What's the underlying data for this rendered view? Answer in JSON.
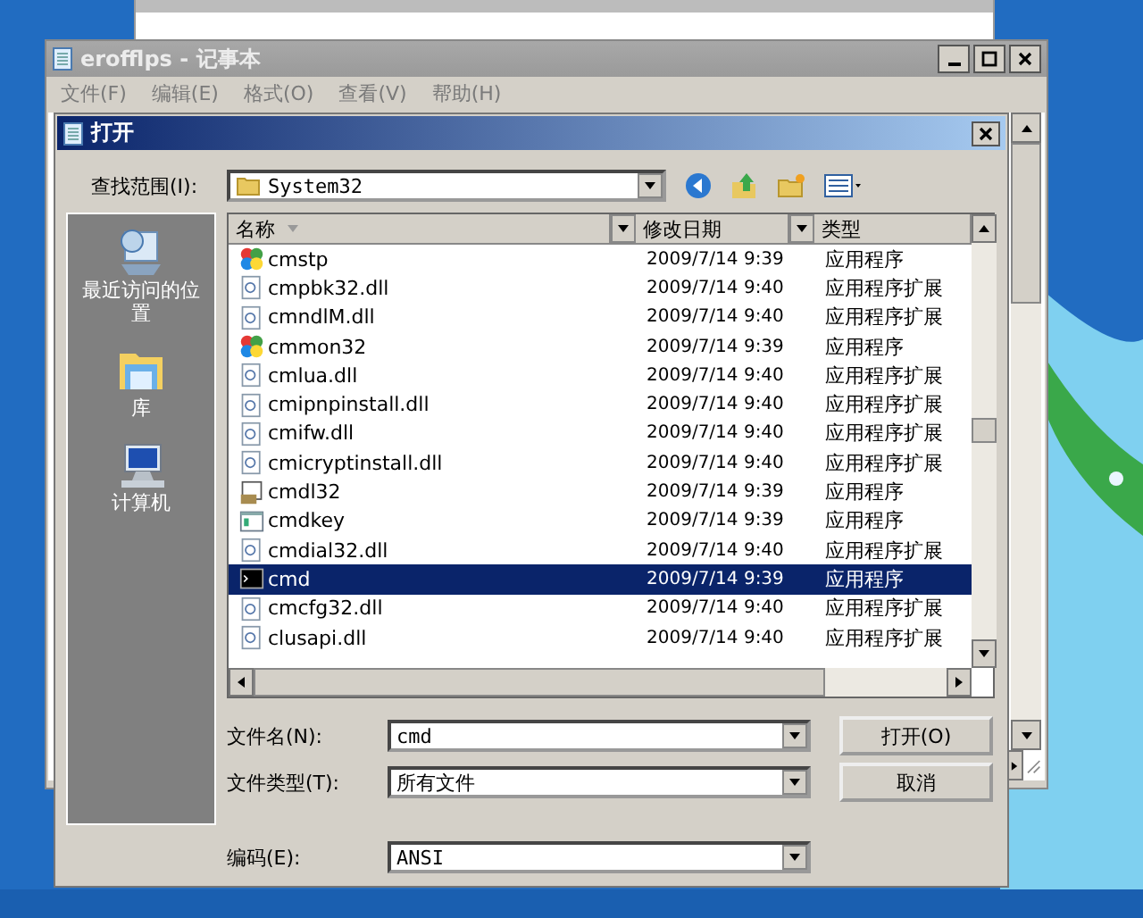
{
  "notepad": {
    "title": "erofflps - 记事本",
    "menu": [
      "文件(F)",
      "编辑(E)",
      "格式(O)",
      "查看(V)",
      "帮助(H)"
    ]
  },
  "dialog": {
    "title": "打开",
    "look_in_label": "查找范围(I):",
    "look_in_value": "System32",
    "places": [
      {
        "label": "最近访问的位置",
        "kind": "recent"
      },
      {
        "label": "库",
        "kind": "library"
      },
      {
        "label": "计算机",
        "kind": "computer"
      }
    ],
    "columns": [
      "名称",
      "修改日期",
      "类型"
    ],
    "rows": [
      {
        "name": "cmstp",
        "date": "2009/7/14 9:39",
        "type": "应用程序",
        "kind": "app",
        "selected": false
      },
      {
        "name": "cmpbk32.dll",
        "date": "2009/7/14 9:40",
        "type": "应用程序扩展",
        "kind": "dll",
        "selected": false
      },
      {
        "name": "cmndlM.dll",
        "date": "2009/7/14 9:40",
        "type": "应用程序扩展",
        "kind": "dll",
        "selected": false
      },
      {
        "name": "cmmon32",
        "date": "2009/7/14 9:39",
        "type": "应用程序",
        "kind": "app",
        "selected": false
      },
      {
        "name": "cmlua.dll",
        "date": "2009/7/14 9:40",
        "type": "应用程序扩展",
        "kind": "dll",
        "selected": false
      },
      {
        "name": "cmipnpinstall.dll",
        "date": "2009/7/14 9:40",
        "type": "应用程序扩展",
        "kind": "dll",
        "selected": false
      },
      {
        "name": "cmifw.dll",
        "date": "2009/7/14 9:40",
        "type": "应用程序扩展",
        "kind": "dll",
        "selected": false
      },
      {
        "name": "cmicryptinstall.dll",
        "date": "2009/7/14 9:40",
        "type": "应用程序扩展",
        "kind": "dll",
        "selected": false
      },
      {
        "name": "cmdl32",
        "date": "2009/7/14 9:39",
        "type": "应用程序",
        "kind": "setup",
        "selected": false
      },
      {
        "name": "cmdkey",
        "date": "2009/7/14 9:39",
        "type": "应用程序",
        "kind": "window",
        "selected": false
      },
      {
        "name": "cmdial32.dll",
        "date": "2009/7/14 9:40",
        "type": "应用程序扩展",
        "kind": "dll",
        "selected": false
      },
      {
        "name": "cmd",
        "date": "2009/7/14 9:39",
        "type": "应用程序",
        "kind": "console",
        "selected": true
      },
      {
        "name": "cmcfg32.dll",
        "date": "2009/7/14 9:40",
        "type": "应用程序扩展",
        "kind": "dll",
        "selected": false
      },
      {
        "name": "clusapi.dll",
        "date": "2009/7/14 9:40",
        "type": "应用程序扩展",
        "kind": "dll",
        "selected": false
      }
    ],
    "fields": [
      {
        "label": "文件名(N):",
        "value": "cmd"
      },
      {
        "label": "文件类型(T):",
        "value": "所有文件"
      },
      {
        "label": "编码(E):",
        "value": "ANSI"
      }
    ],
    "buttons": [
      "打开(O)",
      "取消"
    ]
  }
}
